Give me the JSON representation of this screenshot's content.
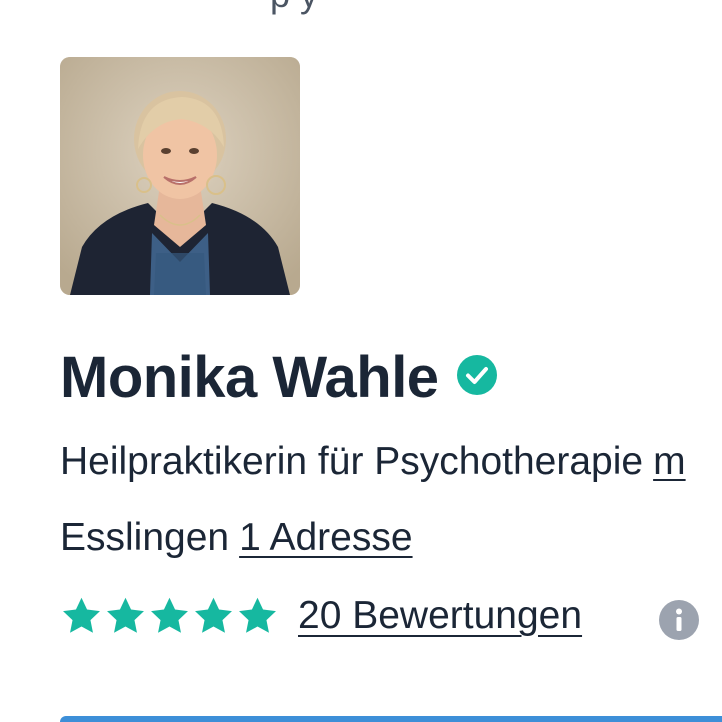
{
  "header": {
    "cut_text": "p          y"
  },
  "profile": {
    "name": "Monika Wahle",
    "profession": "Heilpraktikerin für Psychotherapie",
    "more_link": "m",
    "city": "Esslingen",
    "address_link": "1 Adresse",
    "rating_stars": 5,
    "reviews_link": "20 Bewertungen"
  },
  "icons": {
    "verified": "verified-check-icon",
    "star": "star-icon",
    "info": "info-icon"
  },
  "colors": {
    "accent_teal": "#16b8a0",
    "info_gray": "#9ca3af",
    "text_dark": "#1b2636",
    "bottom_bar_blue": "#3d8fd8"
  }
}
